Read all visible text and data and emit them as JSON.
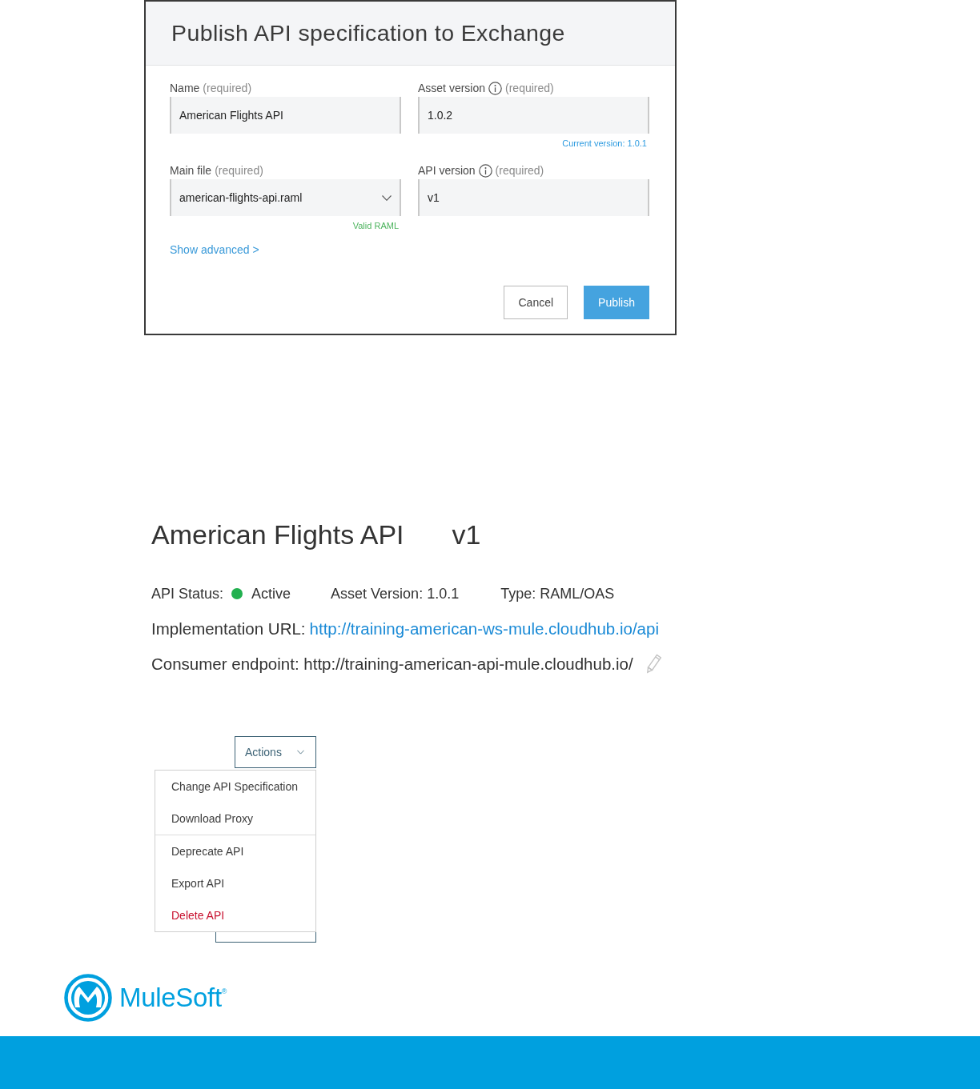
{
  "publish_dialog": {
    "title": "Publish API specification to Exchange",
    "fields": [
      {
        "label": "Name",
        "hint": "(required)",
        "info_icon": false,
        "kind": "text",
        "value": "American Flights API"
      },
      {
        "label": "Asset version",
        "hint": "(required)",
        "info_icon": true,
        "kind": "text",
        "value": "1.0.2",
        "note": {
          "text": "Current version: 1.0.1",
          "kind": "info"
        }
      },
      {
        "label": "Main file",
        "hint": "(required)",
        "info_icon": false,
        "kind": "select",
        "value": "american-flights-api.raml",
        "note": {
          "text": "Valid RAML",
          "kind": "success"
        }
      },
      {
        "label": "API version",
        "hint": "(required)",
        "info_icon": true,
        "kind": "text",
        "value": "v1"
      }
    ],
    "advanced_link": "Show advanced >",
    "buttons": [
      {
        "label": "Cancel",
        "kind": "secondary"
      },
      {
        "label": "Publish",
        "kind": "primary"
      }
    ]
  },
  "api": {
    "name": "American Flights API",
    "version": "v1",
    "status": {
      "label": "API Status:",
      "value": "Active",
      "active": true
    },
    "asset_version": "Asset Version: 1.0.1",
    "type": "Type: RAML/OAS",
    "implementation_url": {
      "label": "Implementation URL:",
      "url": "http://training-american-ws-mule.cloudhub.io/api"
    },
    "consumer_endpoint": "Consumer endpoint: http://training-american-api-mule.cloudhub.io/"
  },
  "actions": {
    "button": "Actions",
    "menu_groups": [
      {
        "items": [
          {
            "label": "Change API Specification",
            "kind": "normal"
          },
          {
            "label": "Download Proxy",
            "kind": "normal"
          }
        ]
      },
      {
        "items": [
          {
            "label": "Deprecate API",
            "kind": "normal"
          },
          {
            "label": "Export API",
            "kind": "normal"
          },
          {
            "label": "Delete API",
            "kind": "danger"
          }
        ]
      }
    ]
  },
  "footer": {
    "logo": "MuleSoft$^{®}$"
  }
}
